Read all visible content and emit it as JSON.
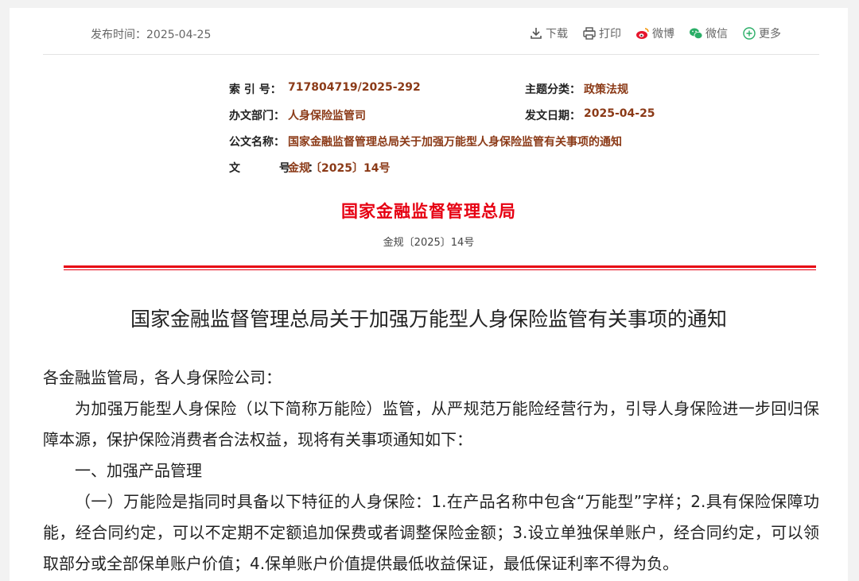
{
  "topbar": {
    "pubdate_label": "发布时间：",
    "pubdate_value": "2025-04-25",
    "tools": [
      {
        "label": "下载",
        "icon": "download-icon"
      },
      {
        "label": "打印",
        "icon": "print-icon"
      },
      {
        "label": "微博",
        "icon": "weibo-icon"
      },
      {
        "label": "微信",
        "icon": "wechat-icon"
      },
      {
        "label": "更多",
        "icon": "plus-circle-icon"
      }
    ]
  },
  "meta": {
    "index_label": "索 引 号：",
    "index_value": "717804719/2025-292",
    "topic_label": "主题分类：",
    "topic_value": "政策法规",
    "dept_label": "办文部门：",
    "dept_value": "人身保险监管司",
    "date_label": "发文日期：",
    "date_value": "2025-04-25",
    "name_label": "公文名称：",
    "name_value": "国家金融监督管理总局关于加强万能型人身保险监管有关事项的通知",
    "docno_label": "文 号：",
    "docno_value": "金规〔2025〕14号"
  },
  "header": {
    "issuer": "国家金融监督管理总局",
    "doc_number": "金规〔2025〕14号"
  },
  "document": {
    "title": "国家金融监督管理总局关于加强万能型人身保险监管有关事项的通知",
    "salutation": "各金融监管局，各人身保险公司：",
    "para1": "为加强万能型人身保险（以下简称万能险）监管，从严规范万能险经营行为，引导人身保险进一步回归保障本源，保护保险消费者合法权益，现将有关事项通知如下：",
    "section1": "一、加强产品管理",
    "para2": "（一）万能险是指同时具备以下特征的人身保险：1.在产品名称中包含“万能型”字样；2.具有保险保障功能，经合同约定，可以不定期不定额追加保费或者调整保险金额；3.设立单独保单账户，经合同约定，可以领取部分或全部保单账户价值；4.保单账户价值提供最低收益保证，最低保证利率不得为负。"
  },
  "colors": {
    "accent_red": "#e60012",
    "meta_value": "#8b3a17"
  }
}
